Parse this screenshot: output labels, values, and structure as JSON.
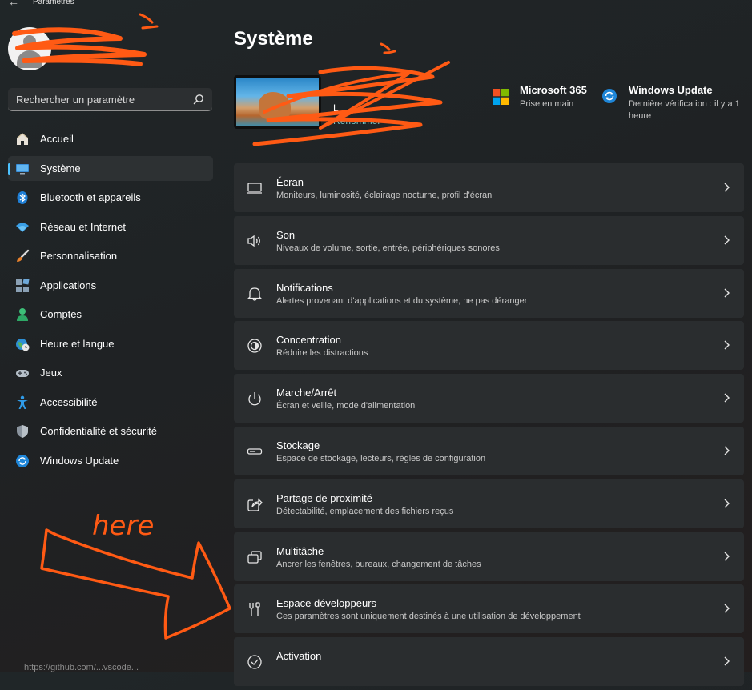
{
  "window": {
    "title": "Paramètres"
  },
  "search": {
    "placeholder": "Rechercher un paramètre"
  },
  "nav": {
    "items": [
      {
        "label": "Accueil",
        "icon": "home-icon"
      },
      {
        "label": "Système",
        "icon": "monitor-icon",
        "active": true
      },
      {
        "label": "Bluetooth et appareils",
        "icon": "bluetooth-icon"
      },
      {
        "label": "Réseau et Internet",
        "icon": "wifi-icon"
      },
      {
        "label": "Personnalisation",
        "icon": "brush-icon"
      },
      {
        "label": "Applications",
        "icon": "apps-icon"
      },
      {
        "label": "Comptes",
        "icon": "person-icon"
      },
      {
        "label": "Heure et langue",
        "icon": "globe-clock-icon"
      },
      {
        "label": "Jeux",
        "icon": "gamepad-icon"
      },
      {
        "label": "Accessibilité",
        "icon": "accessibility-icon"
      },
      {
        "label": "Confidentialité et sécurité",
        "icon": "shield-icon"
      },
      {
        "label": "Windows Update",
        "icon": "update-icon"
      }
    ]
  },
  "main": {
    "title": "Système",
    "device": {
      "name": "L",
      "rename": "Renommer"
    },
    "tiles": [
      {
        "title": "Microsoft 365",
        "subtitle": "Prise en main",
        "icon": "microsoft-logo-icon"
      },
      {
        "title": "Windows Update",
        "subtitle_line1": "Dernière vérification : il y a 1",
        "subtitle_line2": "heure",
        "icon": "update-icon"
      }
    ],
    "settings": [
      {
        "title": "Écran",
        "desc": "Moniteurs, luminosité, éclairage nocturne, profil d'écran",
        "icon": "display-icon"
      },
      {
        "title": "Son",
        "desc": "Niveaux de volume, sortie, entrée, périphériques sonores",
        "icon": "speaker-icon"
      },
      {
        "title": "Notifications",
        "desc": "Alertes provenant d'applications et du système, ne pas déranger",
        "icon": "bell-icon"
      },
      {
        "title": "Concentration",
        "desc": "Réduire les distractions",
        "icon": "focus-icon"
      },
      {
        "title": "Marche/Arrêt",
        "desc": "Écran et veille, mode d'alimentation",
        "icon": "power-icon"
      },
      {
        "title": "Stockage",
        "desc": "Espace de stockage, lecteurs, règles de configuration",
        "icon": "storage-icon"
      },
      {
        "title": "Partage de proximité",
        "desc": "Détectabilité, emplacement des fichiers reçus",
        "icon": "share-icon"
      },
      {
        "title": "Multitâche",
        "desc": "Ancrer les fenêtres, bureaux, changement de tâches",
        "icon": "multitask-icon"
      },
      {
        "title": "Espace développeurs",
        "desc": "Ces paramètres sont uniquement destinés à une utilisation de développement",
        "icon": "developer-tools-icon"
      },
      {
        "title": "Activation",
        "desc": "",
        "icon": "activation-icon"
      }
    ]
  },
  "annotations": {
    "handwritten": "here",
    "color": "#ff5a14"
  },
  "bottom": {
    "text": "https://github.com/...vscode..."
  }
}
